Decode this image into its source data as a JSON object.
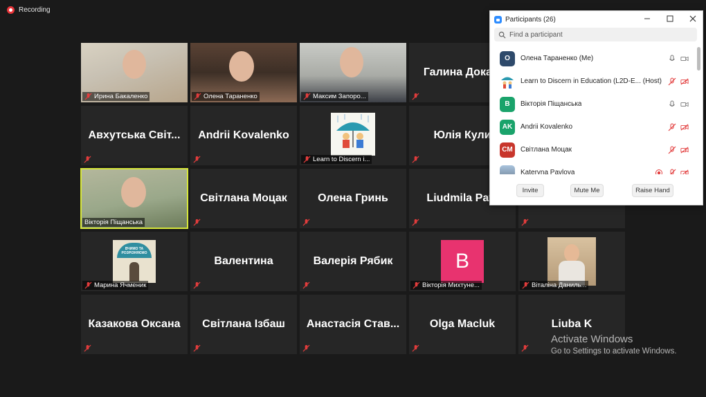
{
  "recording": {
    "label": "Recording"
  },
  "tiles": [
    {
      "name": "Ирина Бакаленко",
      "video": true
    },
    {
      "name": "Олена Тараненко",
      "video": true
    },
    {
      "name": "Максим Запоро...",
      "video": true
    },
    {
      "name": "Галина  Докаш",
      "video": false
    },
    {
      "name": "Авхутська  Світ...",
      "video": false
    },
    {
      "name": "Andrii Kovalenko",
      "video": false
    },
    {
      "name": "Learn to Discern i...",
      "video": true
    },
    {
      "name": "Юлія Кули",
      "video": false
    },
    {
      "name": "Вікторія Піщанська",
      "video": true
    },
    {
      "name": "Світлана Моцак",
      "video": false
    },
    {
      "name": "Олена Гринь",
      "video": false
    },
    {
      "name": "Liudmila  Pavl",
      "video": false
    },
    {
      "name": "Марина Ячменик",
      "video": true
    },
    {
      "name": "Валентина",
      "video": false
    },
    {
      "name": "Валерія Рябик",
      "video": false
    },
    {
      "name": "Вікторія Михтуне...",
      "video": true
    },
    {
      "name": "Віталіна Даниль...",
      "video": true
    },
    {
      "name": "Казакова Оксана",
      "video": false
    },
    {
      "name": "Світлана Ізбаш",
      "video": false
    },
    {
      "name": "Анастасія  Став...",
      "video": false
    },
    {
      "name": "Olga Macluk",
      "video": false
    },
    {
      "name": "Liuba K",
      "video": false
    }
  ],
  "tile_avatar_letter": "B",
  "tile_image_text": "ВЧИМО ТА РОЗРІЗНЯЄМО",
  "participants": {
    "title": "Participants (26)",
    "search_placeholder": "Find a participant",
    "list": [
      {
        "initials": "О",
        "name": "Олена Тараненко (Me)",
        "color": "#2e4a6b",
        "mic": "on",
        "cam": "on"
      },
      {
        "initials": "",
        "name": "Learn to Discern in Education (L2D-E...  (Host)",
        "color": "",
        "mic": "off",
        "cam": "off"
      },
      {
        "initials": "В",
        "name": "Вікторія Піщанська",
        "color": "#1aa36b",
        "mic": "on",
        "cam": "on"
      },
      {
        "initials": "AK",
        "name": "Andrii Kovalenko",
        "color": "#1aa36b",
        "mic": "off",
        "cam": "off"
      },
      {
        "initials": "СМ",
        "name": "Світлана Моцак",
        "color": "#c8362c",
        "mic": "off",
        "cam": "off"
      },
      {
        "initials": "",
        "name": "Kateryna Pavlova",
        "color": "",
        "mic": "off",
        "cam": "off",
        "recording": true
      }
    ],
    "buttons": {
      "invite": "Invite",
      "mute": "Mute Me",
      "raise": "Raise Hand"
    }
  },
  "activate": {
    "title": "Activate Windows",
    "subtitle": "Go to Settings to activate Windows."
  }
}
